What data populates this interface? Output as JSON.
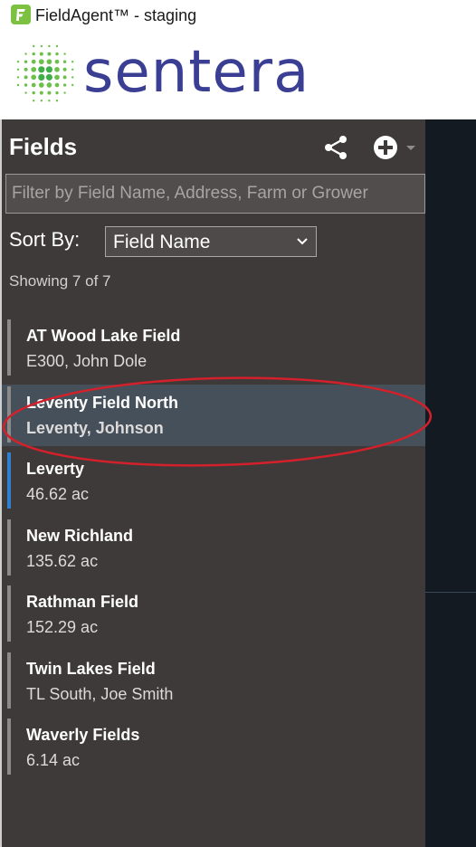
{
  "window": {
    "title": "FieldAgent™ - staging",
    "icon": "fieldagent-logo-icon"
  },
  "brand": {
    "name": "sentera",
    "logo_icon": "sentera-dots-logo",
    "color": "#3a3f94"
  },
  "panel": {
    "title": "Fields",
    "share_icon": "share-icon",
    "add_icon": "add-circle-icon",
    "filter": {
      "placeholder": "Filter by Field Name, Address, Farm or Grower",
      "value": ""
    },
    "sort": {
      "label": "Sort By:",
      "selected": "Field Name"
    },
    "showing": "Showing 7 of 7",
    "fields": [
      {
        "name": "AT Wood Lake Field",
        "sub": "E300, John Dole",
        "bar": "gray",
        "selected": false
      },
      {
        "name": "Leventy Field North",
        "sub": "Leventy, Johnson",
        "bar": "gray",
        "selected": true
      },
      {
        "name": "Leverty",
        "sub": "46.62 ac",
        "bar": "blue",
        "selected": false
      },
      {
        "name": "New Richland",
        "sub": "135.62 ac",
        "bar": "gray",
        "selected": false
      },
      {
        "name": "Rathman Field",
        "sub": "152.29 ac",
        "bar": "gray",
        "selected": false
      },
      {
        "name": "Twin Lakes Field",
        "sub": "TL South, Joe Smith",
        "bar": "gray",
        "selected": false
      },
      {
        "name": "Waverly Fields",
        "sub": "6.14 ac",
        "bar": "gray",
        "selected": false
      }
    ]
  },
  "colors": {
    "panel_bg": "#3d3a39",
    "selected_bg": "#46505a",
    "accent_blue": "#2f80d1",
    "annotation_red": "#d3202a"
  }
}
